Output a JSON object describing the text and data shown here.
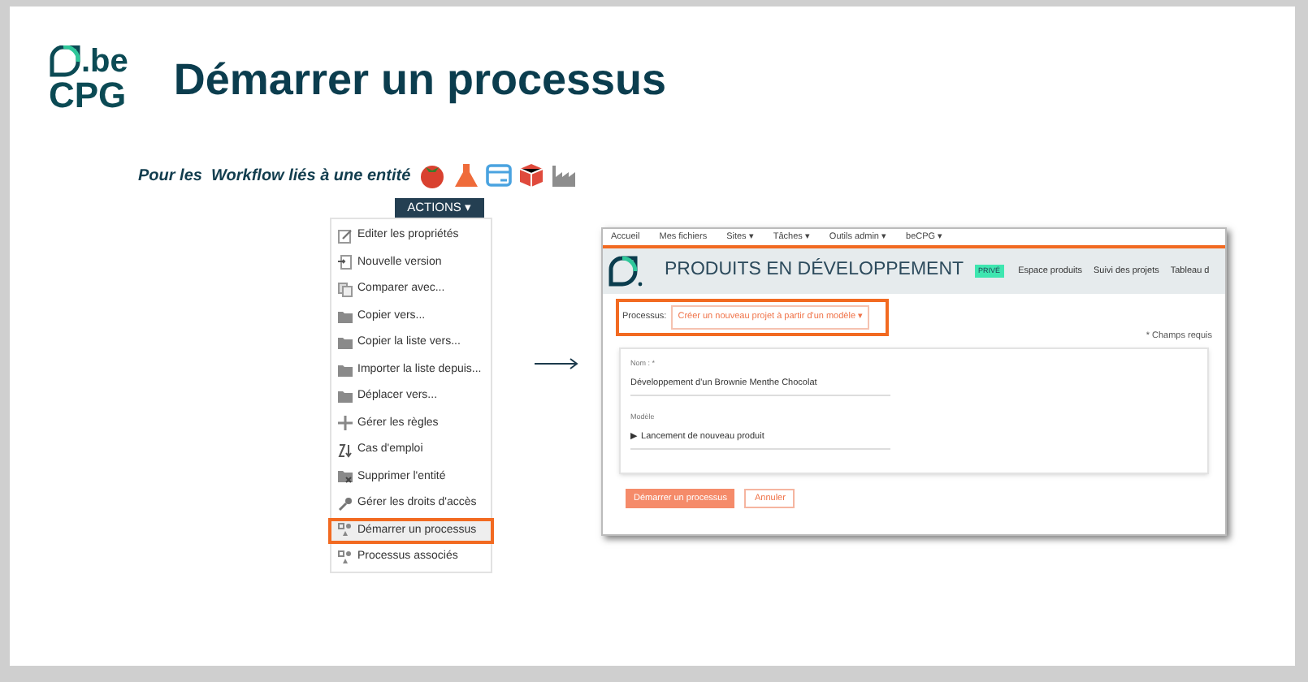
{
  "logo": {
    "top": ".be",
    "bottom": "CPG"
  },
  "title": "Démarrer un processus",
  "subtitle": "Pour les  Workflow liés à une entité",
  "actions_button": "ACTIONS ▾",
  "menu_items": [
    {
      "label": "Editer les propriétés",
      "selected": false
    },
    {
      "label": "Nouvelle version",
      "selected": false
    },
    {
      "label": "Comparer avec...",
      "selected": false
    },
    {
      "label": "Copier vers...",
      "selected": false
    },
    {
      "label": "Copier la liste vers...",
      "selected": false
    },
    {
      "label": "Importer la liste depuis...",
      "selected": false
    },
    {
      "label": "Déplacer vers...",
      "selected": false
    },
    {
      "label": "Gérer les règles",
      "selected": false
    },
    {
      "label": "Cas d'emploi",
      "selected": false
    },
    {
      "label": "Supprimer l'entité",
      "selected": false
    },
    {
      "label": "Gérer les droits d'accès",
      "selected": false
    },
    {
      "label": "Démarrer un processus",
      "selected": true
    },
    {
      "label": "Processus associés",
      "selected": false
    }
  ],
  "app": {
    "nav": [
      "Accueil",
      "Mes fichiers",
      "Sites ▾",
      "Tâches ▾",
      "Outils admin ▾",
      "beCPG ▾"
    ],
    "site_title": "PRODUITS EN DÉVELOPPEMENT",
    "badge": "PRIVÉ",
    "site_links": [
      "Espace produits",
      "Suivi des projets",
      "Tableau d"
    ],
    "process_label": "Processus:",
    "process_value": "Créer un nouveau projet à partir d'un modèle ▾",
    "process_highlighted": true,
    "required_note": "* Champs requis",
    "fields": [
      {
        "label": "Nom : *",
        "value": "Développement d'un Brownie Menthe Chocolat"
      },
      {
        "label": "Modèle",
        "value": "▶ Lancement de nouveau produit"
      }
    ],
    "buttons": [
      {
        "label": "Démarrer un processus",
        "kind": "primary"
      },
      {
        "label": "Annuler",
        "kind": "secondary"
      }
    ]
  }
}
